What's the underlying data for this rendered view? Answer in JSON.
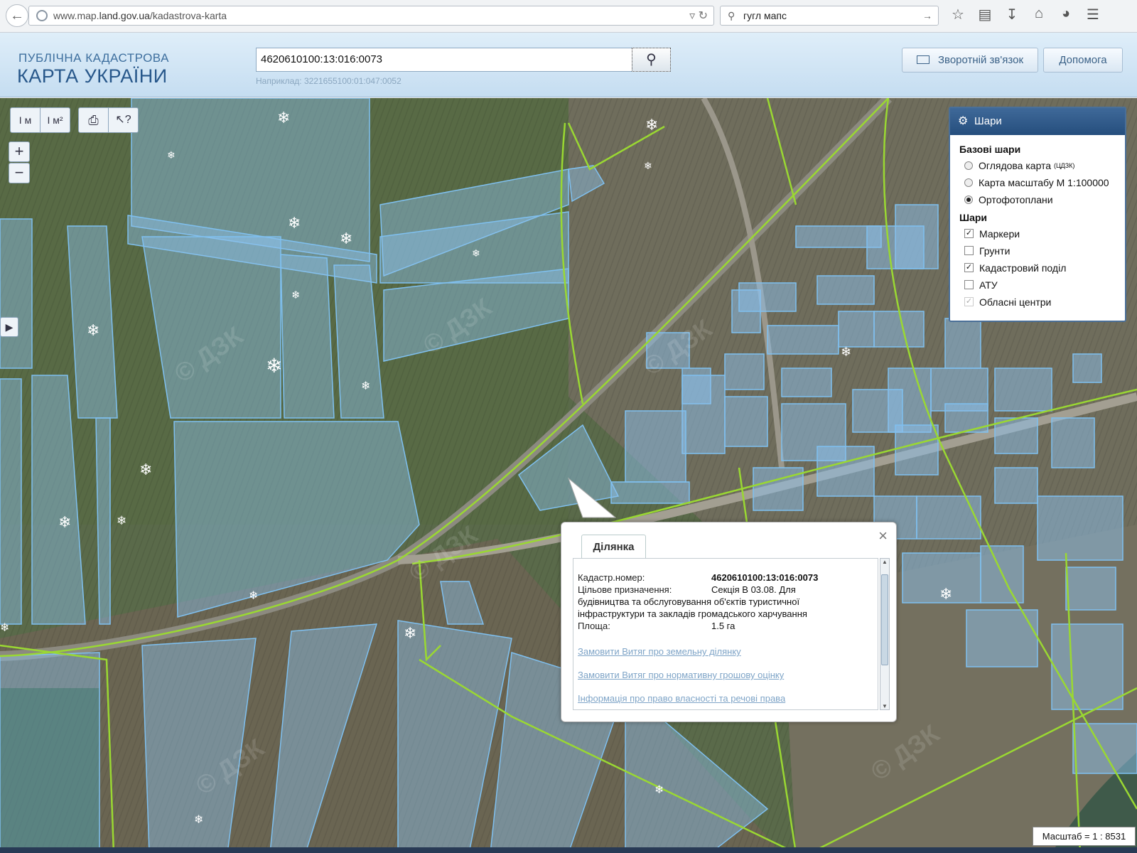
{
  "browser": {
    "url_prefix": "www.map.",
    "url_host": "land.gov.ua",
    "url_path": "/kadastrova-karta",
    "search_text": "гугл мапс"
  },
  "header": {
    "logo_line1": "ПУБЛІЧНА КАДАСТРОВА",
    "logo_line2": "КАРТА УКРАЇНИ",
    "search_value": "4620610100:13:016:0073",
    "example_text": "Наприклад: 3221655100:01:047:0052",
    "feedback_label": "Зворотній зв'язок",
    "help_label": "Допомога"
  },
  "map_tools": {
    "measure_line": "I м",
    "measure_area": "I м²",
    "zoom_in": "+",
    "zoom_out": "−"
  },
  "layers": {
    "title": "Шари",
    "base_title": "Базові шари",
    "base": [
      {
        "label": "Оглядова карта",
        "sup": "(ЦДЗК)",
        "selected": false
      },
      {
        "label": "Карта масштабу М 1:100000",
        "sup": "",
        "selected": false
      },
      {
        "label": "Ортофотоплани",
        "sup": "",
        "selected": true
      }
    ],
    "overlay_title": "Шари",
    "overlays": [
      {
        "label": "Маркери",
        "checked": true,
        "disabled": false
      },
      {
        "label": "Грунти",
        "checked": false,
        "disabled": false
      },
      {
        "label": "Кадастровий поділ",
        "checked": true,
        "disabled": false
      },
      {
        "label": "АТУ",
        "checked": false,
        "disabled": false
      },
      {
        "label": "Обласні центри",
        "checked": true,
        "disabled": true
      }
    ]
  },
  "popup": {
    "tab": "Ділянка",
    "cad_label": "Кадастр.номер:",
    "cad_value": "4620610100:13:016:0073",
    "purpose_label": "Цільове призначення:",
    "purpose_value": "Секція В 03.08. Для",
    "purpose_cont1": "будівництва та обслуговування об'єктів туристичної",
    "purpose_cont2": "інфраструктури та закладів громадського харчування",
    "area_label": "Площа:",
    "area_value": "1.5 га",
    "link1": "Замовити Витяг про земельну ділянку",
    "link2": "Замовити Витяг про нормативну грошову оцінку",
    "link3": "Інформація про право власності та речові права"
  },
  "scale": "Масштаб = 1 : 8531",
  "colors": {
    "parcel_fill": "#8cc0ec",
    "parcel_stroke": "#7fc0f0",
    "boundary": "#9ad832",
    "header_blue": "#27578a"
  }
}
